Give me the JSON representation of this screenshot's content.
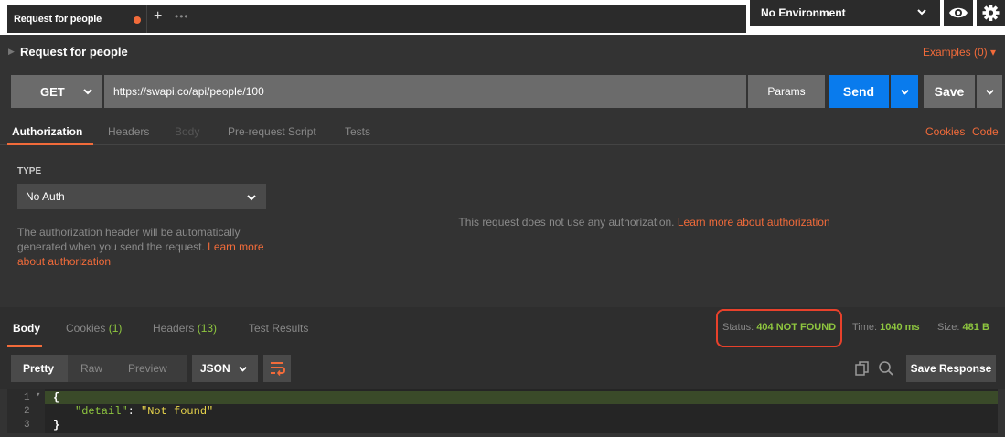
{
  "tab": {
    "title": "Request for people",
    "new_tab": "+",
    "more": "•••"
  },
  "environment": {
    "selected": "No Environment"
  },
  "request": {
    "name": "Request for people",
    "examples_label": "Examples (0) ▾",
    "method": "GET",
    "url": "https://swapi.co/api/people/100",
    "params_label": "Params",
    "send_label": "Send",
    "save_label": "Save"
  },
  "request_tabs": {
    "authorization": "Authorization",
    "headers": "Headers",
    "body": "Body",
    "prerequest": "Pre-request Script",
    "tests": "Tests",
    "cookies": "Cookies",
    "code": "Code"
  },
  "auth": {
    "type_label": "TYPE",
    "selected": "No Auth",
    "help_text": "The authorization header will be automatically generated when you send the request. ",
    "help_link": "Learn more about authorization",
    "message": "This request does not use any authorization. ",
    "message_link": "Learn more about authorization"
  },
  "response_tabs": {
    "body": "Body",
    "cookies": "Cookies",
    "cookies_count": "(1)",
    "headers": "Headers",
    "headers_count": "(13)",
    "tests": "Test Results"
  },
  "response_meta": {
    "status_label": "Status:",
    "status_value": "404 NOT FOUND",
    "time_label": "Time:",
    "time_value": "1040 ms",
    "size_label": "Size:",
    "size_value": "481 B"
  },
  "response_toolbar": {
    "pretty": "Pretty",
    "raw": "Raw",
    "preview": "Preview",
    "format": "JSON",
    "save_response": "Save Response"
  },
  "response_body": {
    "lines": [
      "1",
      "2",
      "3"
    ],
    "open_brace": "{",
    "key": "\"detail\"",
    "colon": ": ",
    "value": "\"Not found\"",
    "close_brace": "}"
  },
  "colors": {
    "accent": "#f26b3a",
    "send": "#097bed",
    "success": "#8ec63f",
    "highlight": "#e8412b"
  }
}
